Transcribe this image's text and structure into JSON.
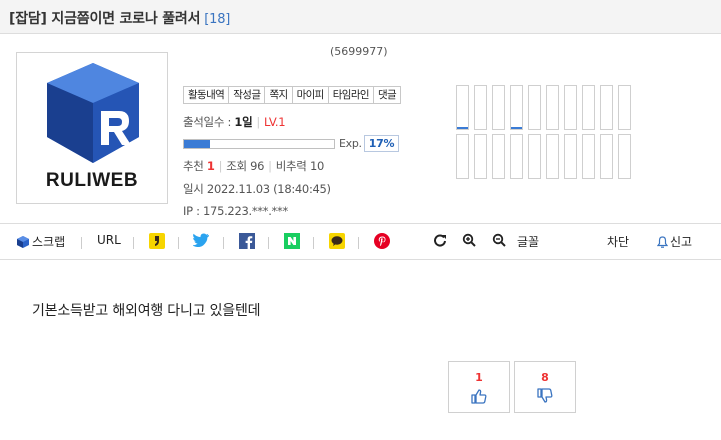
{
  "post": {
    "title": "[잡담] 지금쯤이면 코로나 풀려서",
    "comment_count": "[18]"
  },
  "profile": {
    "user_id": "(5699977)",
    "logo_text": "RULIWEB",
    "tabs": [
      "활동내역",
      "작성글",
      "쪽지",
      "마이피",
      "타임라인",
      "댓글"
    ],
    "attend_label": "출석일수 :",
    "attend_days": "1일",
    "level": "LV.1",
    "exp_label": "Exp.",
    "exp_percent_text": "17%",
    "exp_fraction": 0.17,
    "recommend_label": "추천",
    "recommend_value": "1",
    "views_label": "조회",
    "views_value": "96",
    "downvote_ratio_label": "비추력",
    "downvote_ratio_value": "10",
    "date_label": "일시",
    "date_value": "2022.11.03 (18:40:45)",
    "ip_label": "IP :",
    "ip_value": "175.223.***.***",
    "activity_levels_top": [
      0.05,
      0,
      0,
      0.05,
      0,
      0,
      0,
      0,
      0,
      0
    ],
    "activity_levels_bottom": [
      0,
      0,
      0,
      0,
      0,
      0,
      0,
      0,
      0,
      0
    ]
  },
  "toolbar": {
    "scrap": "스크랩",
    "url": "URL",
    "font": "글꼴",
    "block": "차단",
    "report": "신고"
  },
  "content": {
    "body": "기본소득받고 해외여행 다니고 있을텐데"
  },
  "votes": {
    "up": "1",
    "down": "8"
  },
  "colors": {
    "accent_blue": "#3a7bd5",
    "level_red": "#e33333",
    "logo_blue": "#1f4fa8"
  }
}
